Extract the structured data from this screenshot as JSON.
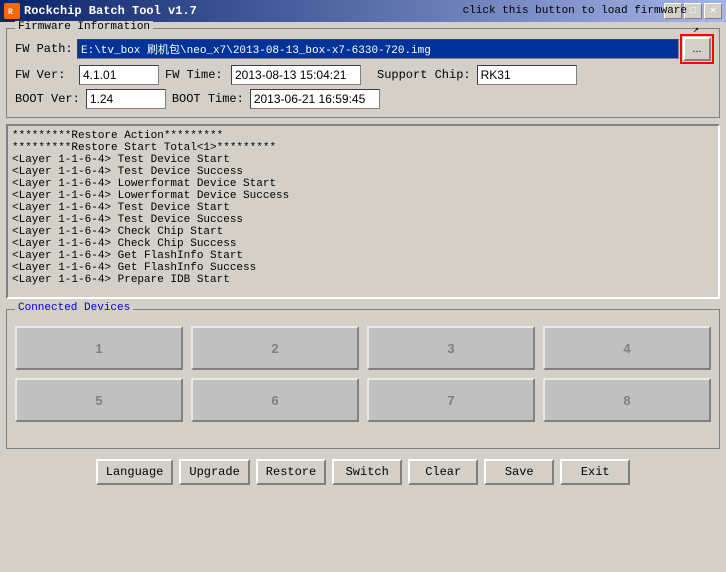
{
  "window": {
    "title": "Rockchip Batch Tool v1.7",
    "icon": "R"
  },
  "titlebar_buttons": {
    "minimize": "−",
    "maximize": "□",
    "close": "✕"
  },
  "firmware": {
    "group_label": "Firmware Information",
    "fw_path_label": "FW Path:",
    "fw_path_value": "E:\\tv_box 刷机包\\neo_x7\\2013-08-13_box-x7-6330-720.img",
    "browse_label": "...",
    "fw_ver_label": "FW Ver:",
    "fw_ver_value": "4.1.01",
    "fw_time_label": "FW Time:",
    "fw_time_value": "2013-08-13 15:04:21",
    "boot_ver_label": "BOOT Ver:",
    "boot_ver_value": "1.24",
    "boot_time_label": "BOOT Time:",
    "boot_time_value": "2013-06-21 16:59:45",
    "support_chip_label": "Support Chip:",
    "support_chip_value": "RK31",
    "tooltip": "click this button to load firmware"
  },
  "log": {
    "content": "*********Restore Action*********\n*********Restore Start Total<1>*********\n<Layer 1-1-6-4> Test Device Start\n<Layer 1-1-6-4> Test Device Success\n<Layer 1-1-6-4> Lowerformat Device Start\n<Layer 1-1-6-4> Lowerformat Device Success\n<Layer 1-1-6-4> Test Device Start\n<Layer 1-1-6-4> Test Device Success\n<Layer 1-1-6-4> Check Chip Start\n<Layer 1-1-6-4> Check Chip Success\n<Layer 1-1-6-4> Get FlashInfo Start\n<Layer 1-1-6-4> Get FlashInfo Success\n<Layer 1-1-6-4> Prepare IDB Start"
  },
  "devices": {
    "label": "Connected Devices",
    "buttons": [
      {
        "id": 1,
        "label": "1"
      },
      {
        "id": 2,
        "label": "2"
      },
      {
        "id": 3,
        "label": "3"
      },
      {
        "id": 4,
        "label": "4"
      },
      {
        "id": 5,
        "label": "5"
      },
      {
        "id": 6,
        "label": "6"
      },
      {
        "id": 7,
        "label": "7"
      },
      {
        "id": 8,
        "label": "8"
      }
    ]
  },
  "buttons": {
    "language": "Language",
    "upgrade": "Upgrade",
    "restore": "Restore",
    "switch": "Switch",
    "clear": "Clear",
    "save": "Save",
    "exit": "Exit"
  }
}
